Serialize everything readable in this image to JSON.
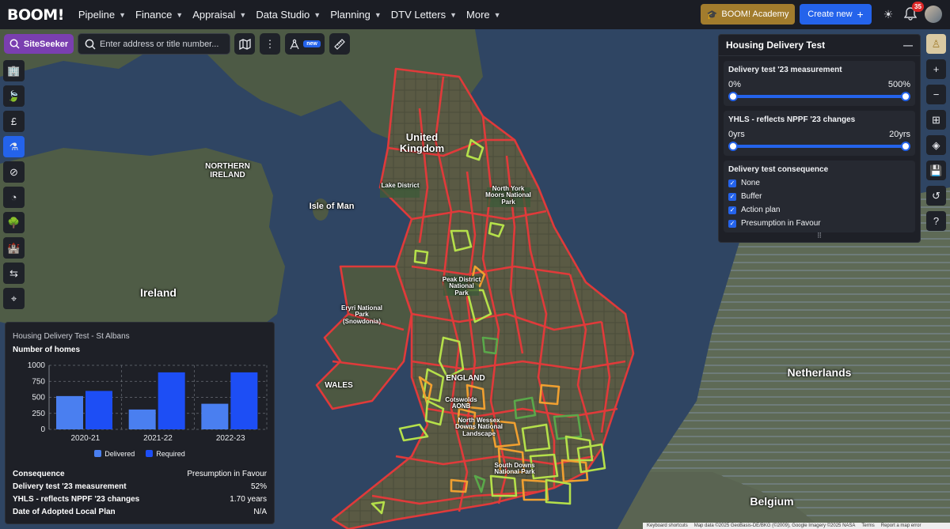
{
  "brand": {
    "logo": "BOOM!"
  },
  "nav": [
    {
      "label": "Pipeline"
    },
    {
      "label": "Finance"
    },
    {
      "label": "Appraisal"
    },
    {
      "label": "Data Studio"
    },
    {
      "label": "Planning"
    },
    {
      "label": "DTV Letters"
    },
    {
      "label": "More"
    }
  ],
  "header": {
    "academy_label": "BOOM! Academy",
    "create_label": "Create new",
    "notifications_count": "35"
  },
  "toolbar": {
    "siteseeker_label": "SiteSeeker",
    "search_placeholder": "Enter address or title number...",
    "new_badge": "new"
  },
  "map_labels": {
    "uk": "United Kingdom",
    "ni": "NORTHERN IRELAND",
    "iom": "Isle of Man",
    "ireland": "Ireland",
    "lake_district": "Lake District",
    "north_york": "North York Moors National Park",
    "peak_district": "Peak District National Park",
    "eryri": "Eryri National Park (Snowdonia)",
    "wales": "WALES",
    "england": "ENGLAND",
    "cotswolds": "Cotswolds AONB",
    "north_wessex": "North Wessex Downs National Landscape",
    "south_downs": "South Downs National Park",
    "netherlands": "Netherlands",
    "belgium": "Belgium"
  },
  "hdt_panel": {
    "title": "Housing Delivery Test",
    "measurement": {
      "title": "Delivery test '23 measurement",
      "min": "0%",
      "max": "500%",
      "low": 0,
      "high": 1
    },
    "yhls": {
      "title": "YHLS - reflects NPPF '23 changes",
      "min": "0yrs",
      "max": "20yrs",
      "low": 0,
      "high": 1
    },
    "consequence": {
      "title": "Delivery test consequence",
      "options": [
        {
          "label": "None",
          "checked": true
        },
        {
          "label": "Buffer",
          "checked": true
        },
        {
          "label": "Action plan",
          "checked": true
        },
        {
          "label": "Presumption in Favour",
          "checked": true
        }
      ]
    }
  },
  "info_panel": {
    "title": "Housing Delivery Test - St Albans",
    "subtitle": "Number of homes",
    "stats": [
      {
        "key": "Consequence",
        "value": "Presumption in Favour"
      },
      {
        "key": "Delivery test '23 measurement",
        "value": "52%"
      },
      {
        "key": "YHLS - reflects NPPF '23 changes",
        "value": "1.70 years"
      },
      {
        "key": "Date of Adopted Local Plan",
        "value": "N/A"
      }
    ]
  },
  "chart_data": {
    "type": "bar",
    "categories": [
      "2020-21",
      "2021-22",
      "2022-23"
    ],
    "series": [
      {
        "name": "Delivered",
        "color": "#4a7ff0",
        "values": [
          520,
          310,
          400
        ]
      },
      {
        "name": "Required",
        "color": "#1d4ef5",
        "values": [
          600,
          890,
          890
        ]
      }
    ],
    "yticks": [
      "0",
      "250",
      "500",
      "750",
      "1000"
    ],
    "ylim": [
      0,
      1000
    ],
    "grid": true,
    "legend": "bottom"
  },
  "attribution": [
    "Keyboard shortcuts",
    "Map data ©2025 GeoBasis-DE/BKG (©2009), Google Imagery ©2025 NASA",
    "Terms",
    "Report a map error"
  ],
  "colors": {
    "accent": "#2463eb",
    "brand_purple": "#7a3fb0",
    "academy_gold": "#a27c2d",
    "boundary_red": "#e03a3a",
    "boundary_orange": "#f0a030",
    "boundary_green": "#b5e04a"
  }
}
